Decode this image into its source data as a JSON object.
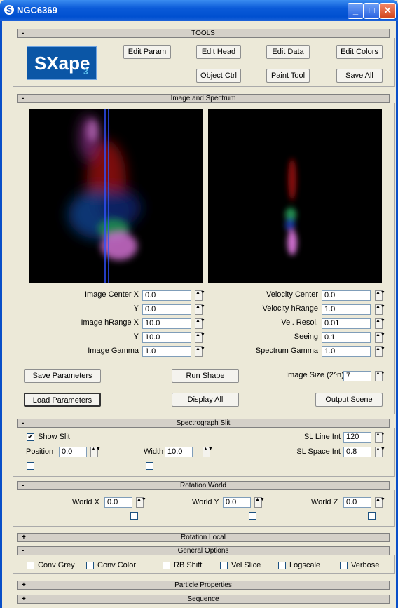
{
  "window": {
    "title": "NGC6369",
    "app_icon": "app-logo-icon",
    "buttons": [
      "minimize-icon",
      "maximize-icon",
      "close-icon"
    ]
  },
  "tools": {
    "header": "TOOLS",
    "sign": "-",
    "logo": {
      "text": "SXape",
      "sub": "3"
    },
    "buttons": [
      "Edit Param",
      "Edit Head",
      "Edit Data",
      "Edit Colors",
      "Object Ctrl",
      "Paint Tool",
      "Save All"
    ]
  },
  "image_spectrum": {
    "header": "Image and Spectrum",
    "sign": "-",
    "left_fields": [
      {
        "label": "Image  Center X",
        "value": "0.0"
      },
      {
        "label": "Y",
        "value": "0.0"
      },
      {
        "label": "Image hRange X",
        "value": "10.0"
      },
      {
        "label": "Y",
        "value": "10.0"
      },
      {
        "label": "Image  Gamma",
        "value": "1.0"
      }
    ],
    "right_fields": [
      {
        "label": "Velocity  Center",
        "value": "0.0"
      },
      {
        "label": "Velocity hRange",
        "value": "1.0"
      },
      {
        "label": "Vel. Resol.",
        "value": "0.01"
      },
      {
        "label": "Seeing",
        "value": "0.1"
      },
      {
        "label": "Spectrum  Gamma",
        "value": "1.0"
      }
    ],
    "save_params": "Save Parameters",
    "run_shape": "Run Shape",
    "image_size_label": "Image Size (2^n)",
    "image_size_value": "7",
    "load_params": "Load Parameters",
    "display_all": "Display All",
    "output_scene": "Output Scene"
  },
  "slit": {
    "header": "Spectrograph Slit",
    "sign": "-",
    "show_slit": "Show Slit",
    "show_slit_checked": "✔",
    "position_label": "Position",
    "position_value": "0.0",
    "width_label": "Width",
    "width_value": "10.0",
    "sl_line_label": "SL Line Int",
    "sl_line_value": "120",
    "sl_space_label": "SL Space Int",
    "sl_space_value": "0.8"
  },
  "rotation_world": {
    "header": "Rotation World",
    "sign": "-",
    "x_label": "World X",
    "x_value": "0.0",
    "y_label": "World Y",
    "y_value": "0.0",
    "z_label": "World Z",
    "z_value": "0.0"
  },
  "rotation_local": {
    "header": "Rotation Local",
    "sign": "+"
  },
  "general": {
    "header": "General Options",
    "sign": "-",
    "options": [
      "Conv Grey",
      "Conv Color",
      "RB Shift",
      "Vel Slice",
      "Logscale",
      "Verbose"
    ]
  },
  "particle": {
    "header": "Particle Properties",
    "sign": "+"
  },
  "sequence": {
    "header": "Sequence",
    "sign": "+"
  },
  "spinner_glyph": "▲▼"
}
